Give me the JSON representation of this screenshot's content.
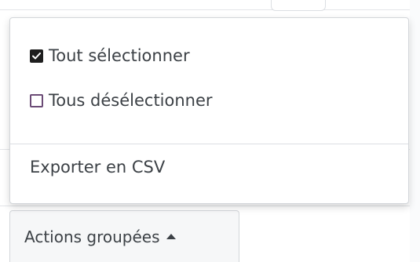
{
  "menu": {
    "items": [
      {
        "label": "Tout sélectionner",
        "checked": true
      },
      {
        "label": "Tous désélectionner",
        "checked": false
      },
      {
        "label": "Exporter en CSV"
      }
    ]
  },
  "button": {
    "label": "Actions groupées",
    "icon": "caret-up-icon"
  },
  "colors": {
    "text": "#3c4146",
    "border": "#d3d6da",
    "checkbox_checked": "#1e1e1e",
    "checkbox_unchecked_border": "#6b4b76"
  }
}
